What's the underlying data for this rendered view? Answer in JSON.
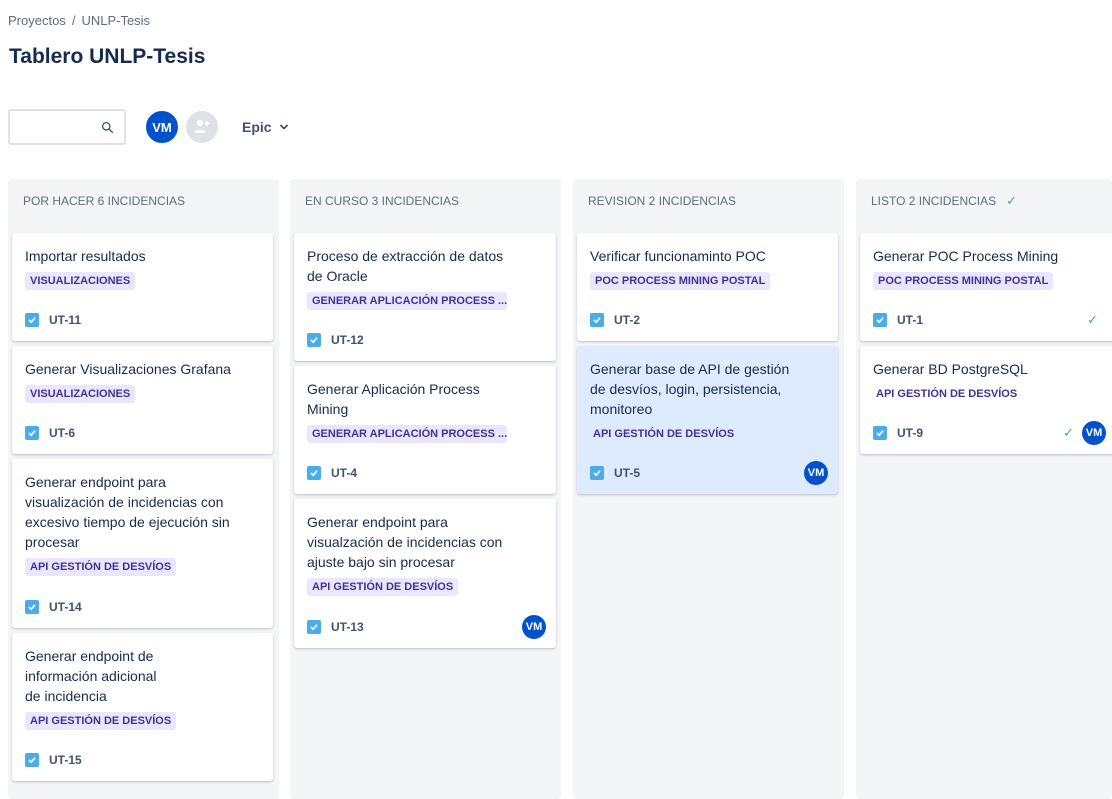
{
  "breadcrumb": {
    "projects": "Proyectos",
    "separator": "/",
    "current": "UNLP-Tesis"
  },
  "page_title": "Tablero UNLP-Tesis",
  "toolbar": {
    "search_placeholder": "",
    "user_avatar_initials": "VM",
    "epic_filter_label": "Epic"
  },
  "columns": [
    {
      "header": "POR HACER 6 INCIDENCIAS",
      "cards": [
        {
          "title": "Importar resultados",
          "epic": "VISUALIZACIONES",
          "key": "UT-11"
        },
        {
          "title": "Generar Visualizaciones Grafana",
          "epic": "VISUALIZACIONES",
          "key": "UT-6"
        },
        {
          "title": "Generar endpoint para visualización de incidencias con excesivo tiempo de ejecución sin procesar",
          "epic": "API GESTIÓN DE DESVÍOS",
          "key": "UT-14"
        },
        {
          "title": "Generar endpoint de información adicional de incidencia",
          "epic": "API GESTIÓN DE DESVÍOS",
          "key": "UT-15"
        }
      ]
    },
    {
      "header": "EN CURSO 3 INCIDENCIAS",
      "cards": [
        {
          "title": "Proceso de extracción de datos de Oracle",
          "epic": "GENERAR APLICACIÓN PROCESS ...",
          "key": "UT-12"
        },
        {
          "title": "Generar Aplicación Process Mining",
          "epic": "GENERAR APLICACIÓN PROCESS ...",
          "key": "UT-4"
        },
        {
          "title": "Generar endpoint para visualzación de incidencias con ajuste bajo sin procesar",
          "epic": "API GESTIÓN DE DESVÍOS",
          "key": "UT-13",
          "assignee": "VM"
        }
      ]
    },
    {
      "header": "REVISION 2 INCIDENCIAS",
      "cards": [
        {
          "title": "Verificar funcionaminto POC",
          "epic": "POC PROCESS MINING POSTAL",
          "key": "UT-2"
        },
        {
          "title": "Generar base de API de gestión de desvíos, login, persistencia, monitoreo",
          "epic": "API GESTIÓN DE DESVÍOS",
          "key": "UT-5",
          "assignee": "VM"
        }
      ]
    },
    {
      "header": "LISTO 2 INCIDENCIAS",
      "cards": [
        {
          "title": "Generar POC Process Mining",
          "epic": "POC PROCESS MINING POSTAL",
          "key": "UT-1"
        },
        {
          "title": "Generar BD PostgreSQL",
          "epic": "API GESTIÓN DE DESVÍOS",
          "key": "UT-9",
          "assignee": "VM"
        }
      ]
    }
  ],
  "colors": {
    "column_bg": "#f4f5f7",
    "epic_bg": "#eae6ff",
    "epic_text": "#403294",
    "task_icon": "#4bade8",
    "avatar": "#0052cc",
    "done": "#36b37e",
    "selected_card": "#deebff"
  },
  "icons": {
    "search": "search-icon",
    "add_people": "add-people-icon",
    "epic_dropdown": "chevron-down-icon",
    "task": "task-checkbox-icon",
    "done": "checkmark-icon"
  }
}
